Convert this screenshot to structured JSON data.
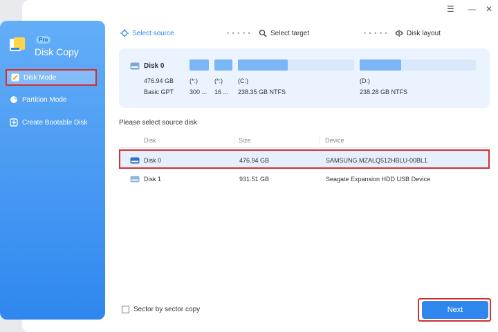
{
  "window_controls": {
    "menu": "☰",
    "minimize": "—",
    "close": "✕"
  },
  "sidebar": {
    "pro_badge": "Pro",
    "app_title": "Disk Copy",
    "items": [
      {
        "label": "Disk Mode",
        "icon": "disk-mode-icon",
        "active": true
      },
      {
        "label": "Partition Mode",
        "icon": "pie-chart-icon",
        "active": false
      },
      {
        "label": "Create Bootable Disk",
        "icon": "bootable-disk-icon",
        "active": false
      }
    ]
  },
  "steps": [
    {
      "label": "Select source",
      "icon": "crosshair-icon",
      "active": true
    },
    {
      "label": "Select target",
      "icon": "search-icon",
      "active": false
    },
    {
      "label": "Disk layout",
      "icon": "layout-icon",
      "active": false
    }
  ],
  "step_separator": "• • • • •",
  "disk_card": {
    "name": "Disk 0",
    "size": "476.94 GB",
    "type": "Basic GPT",
    "partitions": [
      {
        "label": "(*:)",
        "detail": "300 ...",
        "usage": 1.0
      },
      {
        "label": "(*:)",
        "detail": "16 ...",
        "usage": 1.0
      },
      {
        "label": "(C:)",
        "detail": "238.35 GB NTFS",
        "usage": 0.43
      },
      {
        "label": "(D:)",
        "detail": "238.28 GB NTFS",
        "usage": 0.36
      }
    ]
  },
  "section_title": "Please select source disk",
  "table": {
    "headers": [
      "Disk",
      "Size",
      "Device"
    ],
    "rows": [
      {
        "disk": "Disk 0",
        "size": "476.94 GB",
        "device": "SAMSUNG MZALQ512HBLU-00BL1",
        "selected": true
      },
      {
        "disk": "Disk 1",
        "size": "931.51 GB",
        "device": "Seagate  Expansion HDD    USB Device",
        "selected": false
      }
    ]
  },
  "options": {
    "sector_copy_label": "Sector by sector copy",
    "sector_copy_checked": false
  },
  "buttons": {
    "next": "Next"
  },
  "colors": {
    "accent": "#2f87ee",
    "highlight": "#d32f2f",
    "card_bg": "#eaf3fe"
  }
}
